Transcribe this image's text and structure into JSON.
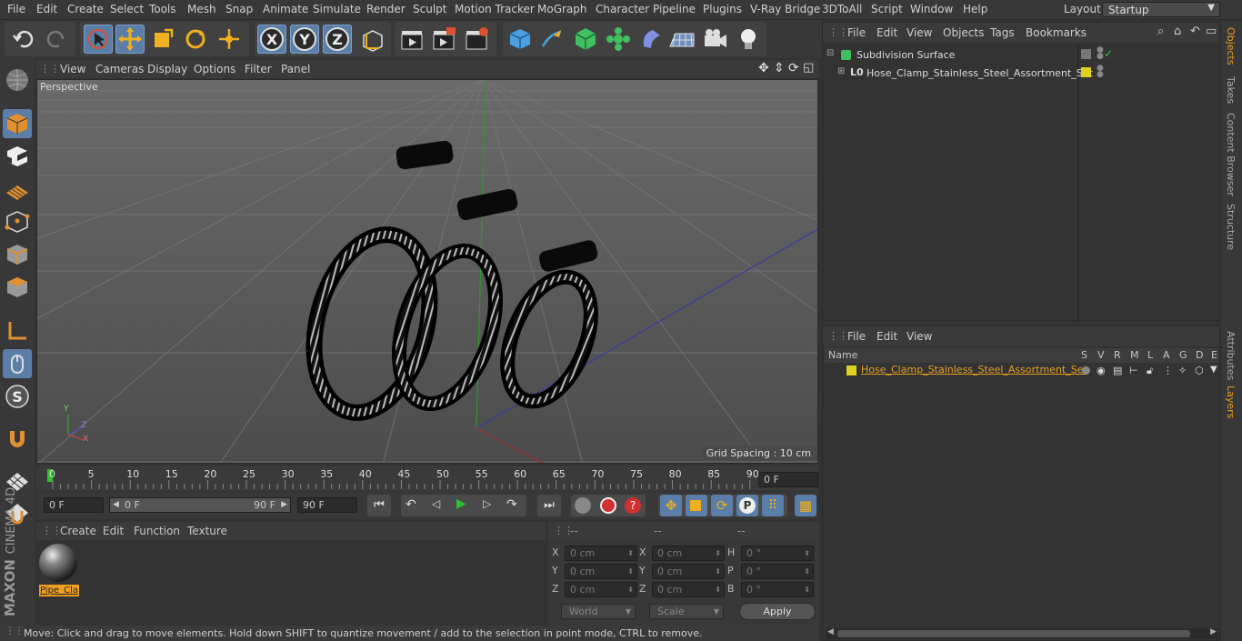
{
  "menubar": {
    "items": [
      "File",
      "Edit",
      "Create",
      "Select",
      "Tools",
      "Mesh",
      "Snap",
      "Animate",
      "Simulate",
      "Render",
      "Sculpt",
      "Motion Tracker",
      "MoGraph",
      "Character",
      "Pipeline",
      "Plugins",
      "V-Ray Bridge",
      "3DToAll",
      "Script",
      "Window",
      "Help"
    ],
    "layout_label": "Layout:",
    "layout_value": "Startup"
  },
  "viewport": {
    "menu": [
      "View",
      "Cameras",
      "Display",
      "Options",
      "Filter",
      "Panel"
    ],
    "camera_label": "Perspective",
    "grid_spacing": "Grid Spacing : 10 cm",
    "axis_x": "X",
    "axis_y": "Y",
    "axis_z": "Z"
  },
  "timeline": {
    "ticks": [
      "0",
      "5",
      "10",
      "15",
      "20",
      "25",
      "30",
      "35",
      "40",
      "45",
      "50",
      "55",
      "60",
      "65",
      "70",
      "75",
      "80",
      "85",
      "90"
    ],
    "current_frame": "0 F"
  },
  "transport": {
    "start": "0 F",
    "range_start": "0 F",
    "range_end": "90 F",
    "end": "90 F"
  },
  "material_panel": {
    "menu": [
      "Create",
      "Edit",
      "Function",
      "Texture"
    ],
    "material_name": "Pipe_Cla"
  },
  "coords": {
    "headers": [
      "--",
      "--",
      "--"
    ],
    "rows": [
      {
        "a": "X",
        "av": "0 cm",
        "b": "X",
        "bv": "0 cm",
        "c": "H",
        "cv": "0 °"
      },
      {
        "a": "Y",
        "av": "0 cm",
        "b": "Y",
        "bv": "0 cm",
        "c": "P",
        "cv": "0 °"
      },
      {
        "a": "Z",
        "av": "0 cm",
        "b": "Z",
        "bv": "0 cm",
        "c": "B",
        "cv": "0 °"
      }
    ],
    "world": "World",
    "scale": "Scale",
    "apply": "Apply"
  },
  "status": "Move: Click and drag to move elements. Hold down SHIFT to quantize movement / add to the selection in point mode, CTRL to remove.",
  "object_manager": {
    "menu": [
      "File",
      "Edit",
      "View",
      "Objects",
      "Tags",
      "Bookmarks"
    ],
    "objects": [
      "Subdivision Surface",
      "Hose_Clamp_Stainless_Steel_Assortment_Set"
    ]
  },
  "layer_manager": {
    "menu": [
      "File",
      "Edit",
      "View"
    ],
    "columns": [
      "Name",
      "S",
      "V",
      "R",
      "M",
      "L",
      "A",
      "G",
      "D",
      "E"
    ],
    "layer_name": "Hose_Clamp_Stainless_Steel_Assortment_Set"
  },
  "right_tabs": [
    "Objects",
    "Takes",
    "Content Browser",
    "Structure",
    "Attributes",
    "Layers"
  ],
  "brand": {
    "maxon": "MAXON",
    "cinema": "CINEMA 4D"
  },
  "colors": {
    "accent": "#5a7ea8",
    "highlight": "#e8a020",
    "layer_yellow": "#e0d020"
  }
}
